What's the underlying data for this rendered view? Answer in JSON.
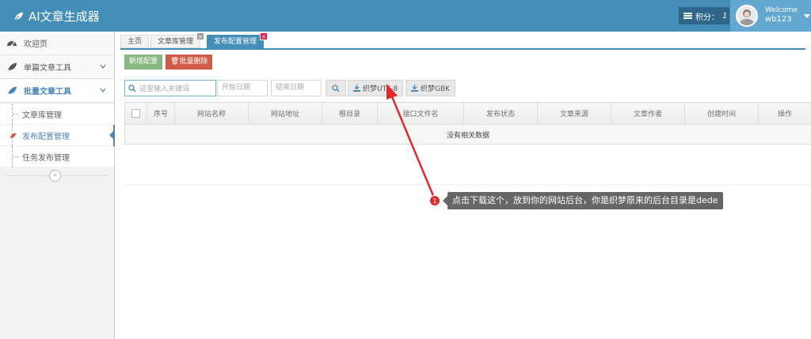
{
  "app": {
    "title": "AI文章生成器"
  },
  "header": {
    "points_label": "积分：",
    "points_value": "1",
    "welcome_label": "Welcome",
    "username": "wb123"
  },
  "sidebar": {
    "items": [
      {
        "label": "欢迎页",
        "icon": "tachometer-icon"
      },
      {
        "label": "单篇文章工具",
        "icon": "leaf-icon"
      },
      {
        "label": "批量文章工具",
        "icon": "leaf-icon"
      }
    ],
    "sub_items": [
      {
        "label": "文章库管理"
      },
      {
        "label": "发布配置管理"
      },
      {
        "label": "任务发布管理"
      }
    ],
    "collapse_glyph": "«"
  },
  "tabs": [
    {
      "label": "主页"
    },
    {
      "label": "文章库管理"
    },
    {
      "label": "发布配置管理"
    }
  ],
  "tab_close_glyph": "×",
  "toolbar": {
    "add_label": "新增配置",
    "batch_delete_label": "批量删除"
  },
  "filters": {
    "search_placeholder": "这里输入关键词",
    "start_date_placeholder": "开始日期",
    "end_date_placeholder": "结束日期",
    "download_utf8_label": "织梦UTF-8",
    "download_gbk_label": "织梦GBK"
  },
  "table": {
    "columns": [
      "序号",
      "网站名称",
      "网站地址",
      "根目录",
      "接口文件名",
      "发布状态",
      "文章来源",
      "文章作者",
      "创建时间",
      "操作"
    ],
    "empty_message": "没有相关数据"
  },
  "annotation": {
    "badge": "1",
    "text": "点击下载这个，放到你的网站后台，你是织梦原来的后台目录是dede",
    "color": "#e02a2a"
  },
  "colors": {
    "header_bg": "#438eb9",
    "accent": "#4b88b7",
    "green_button": "#87b87f",
    "red_button": "#d15b47"
  }
}
